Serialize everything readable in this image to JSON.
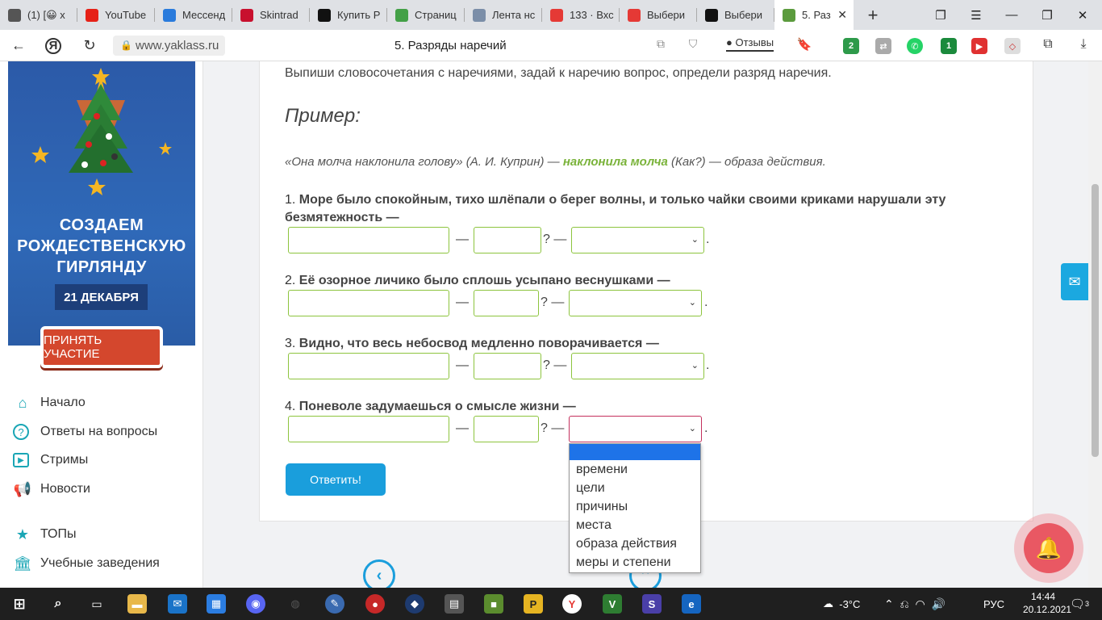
{
  "browser": {
    "tabs": [
      {
        "label": "(1) [😀 х",
        "color": "#555"
      },
      {
        "label": "YouTube",
        "color": "#e62117"
      },
      {
        "label": "Мессенд",
        "color": "#2a7bdc"
      },
      {
        "label": "Skintrad",
        "color": "#c8102e"
      },
      {
        "label": "Купить Р",
        "color": "#111"
      },
      {
        "label": "Страниц",
        "color": "#43a047"
      },
      {
        "label": "Лента нс",
        "color": "#7b8ea8"
      },
      {
        "label": "133 · Вхс",
        "color": "#e53935"
      },
      {
        "label": "Выбери",
        "color": "#e53935"
      },
      {
        "label": "Выбери",
        "color": "#111"
      },
      {
        "label": "5. Раз",
        "color": "#5b9b3d"
      }
    ],
    "active_tab_close": "✕",
    "new_tab": "+",
    "url": "www.yaklass.ru",
    "page_title": "5. Разряды наречий",
    "reviews_label": "Отзывы",
    "extension_badges": [
      "2",
      "1"
    ]
  },
  "sidebar": {
    "banner": {
      "headline_lines": [
        "СОЗДАЕМ",
        "РОЖДЕСТВЕНСКУЮ",
        "ГИРЛЯНДУ"
      ],
      "date": "21 ДЕКАБРЯ",
      "cta": "ПРИНЯТЬ УЧАСТИЕ"
    },
    "nav": [
      {
        "label": "Начало",
        "icon": "home-icon"
      },
      {
        "label": "Ответы на вопросы",
        "icon": "question-icon"
      },
      {
        "label": "Стримы",
        "icon": "play-icon"
      },
      {
        "label": "Новости",
        "icon": "megaphone-icon"
      },
      {
        "label": "ТОПы",
        "icon": "star-icon"
      },
      {
        "label": "Учебные заведения",
        "icon": "institution-icon"
      }
    ]
  },
  "task": {
    "instruction": "Выпиши словосочетания с наречиями, задай к наречию вопрос, определи разряд наречия.",
    "example_heading": "Пример:",
    "example_pre": "«Она молча наклонила голову» (А. И. Куприн) — ",
    "example_highlight": "наклонила молча",
    "example_post": " (Как?) — образа действия.",
    "questions": [
      {
        "num": "1.",
        "text": "Море было спокойным, тихо шлёпали о берег волны, и только чайки своими криками нарушали эту безмятежность —"
      },
      {
        "num": "2.",
        "text": "Её озорное личико было сплошь усыпано веснушками —"
      },
      {
        "num": "3.",
        "text": "Видно, что весь небосвод медленно поворачивается —"
      },
      {
        "num": "4.",
        "text": "Поневоле задумаешься о смысле жизни —"
      }
    ],
    "dash": "—",
    "question_dash": "? —",
    "period": ".",
    "dropdown_options": [
      "",
      "времени",
      "цели",
      "причины",
      "места",
      "образа действия",
      "меры и степени"
    ],
    "submit_label": "Ответить!"
  },
  "taskbar": {
    "weather": "-3°C",
    "lang": "РУС",
    "time": "14:44",
    "date": "20.12.2021",
    "notifications": "3"
  }
}
